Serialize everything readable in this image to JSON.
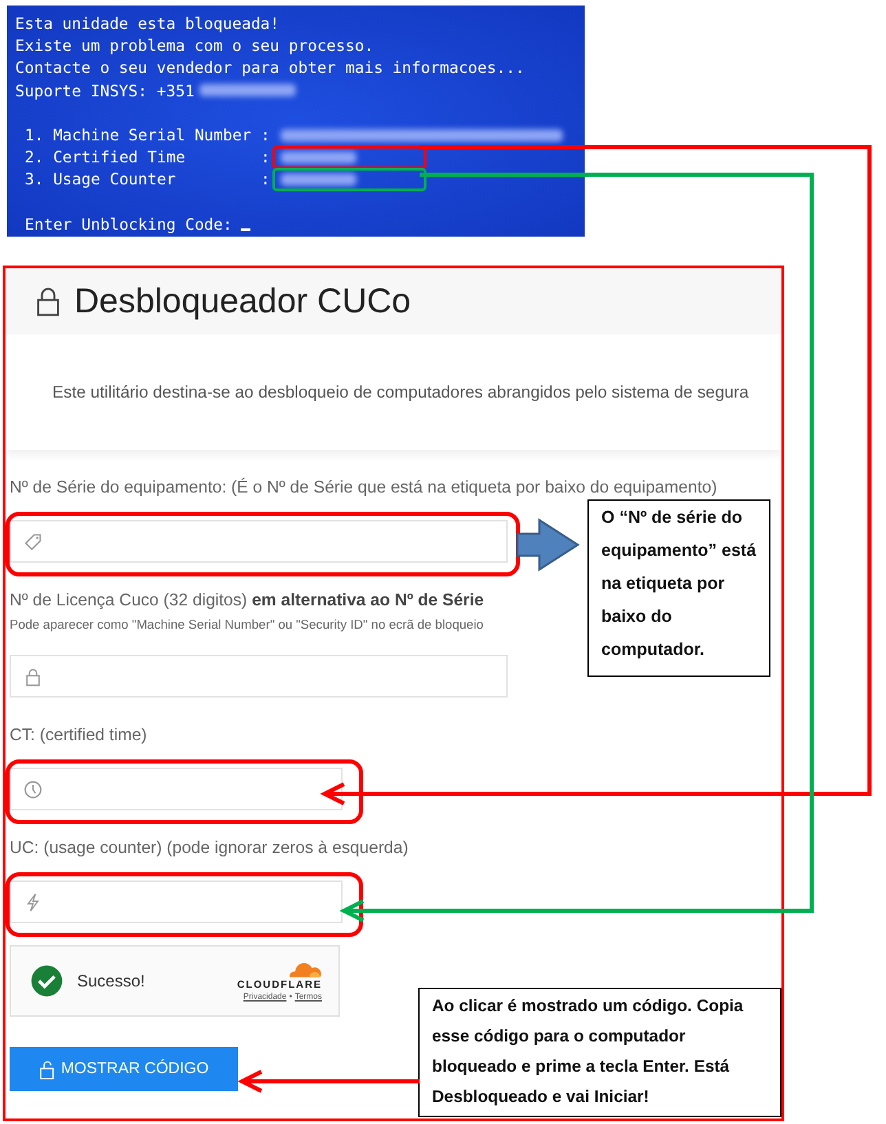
{
  "terminal": {
    "lines": [
      "Esta unidade esta bloqueada!",
      "Existe um problema com o seu processo.",
      "Contacte o seu vendedor para obter mais informacoes...",
      "Suporte INSYS: +351"
    ],
    "fields": [
      {
        "label": "1. Machine Serial Number :"
      },
      {
        "label": "2. Certified Time        :",
        "color": "#ff0000"
      },
      {
        "label": "3. Usage Counter         :",
        "color": "#00b050"
      }
    ],
    "prompt": "Enter Unblocking Code:"
  },
  "page": {
    "title": "Desbloqueador CUCo",
    "intro": "Este utilitário destina-se ao desbloqueio de computadores abrangidos pelo sistema de segura",
    "fields": [
      {
        "label": "Nº de Série do equipamento: (É o Nº de Série que está na etiqueta por baixo do equipamento)",
        "highlighted": true
      },
      {
        "label": "Nº de Licença Cuco (32 digitos) **em alternativa ao Nº de Série**",
        "hint": "Pode aparecer como \"Machine Serial Number\" ou \"Security ID\" no ecrã de bloqueio",
        "highlighted": false
      },
      {
        "label": "CT: (certified time)",
        "highlighted": true
      },
      {
        "label": "UC: (usage counter) (pode ignorar zeros à esquerda)",
        "highlighted": true
      }
    ],
    "captcha": {
      "status": "Sucesso!",
      "brand": "CLOUDFLARE",
      "links": [
        "Privacidade",
        "Termos"
      ],
      "separator": "•"
    },
    "button": "MOSTRAR CÓDIGO"
  },
  "callouts": [
    "O “Nº de série do equipamento” está na etiqueta por baixo do computador.",
    "Ao clicar é mostrado um código. Copia esse código para  o computador bloqueado e prime a tecla Enter. Está Desbloqueado e vai Iniciar!"
  ]
}
